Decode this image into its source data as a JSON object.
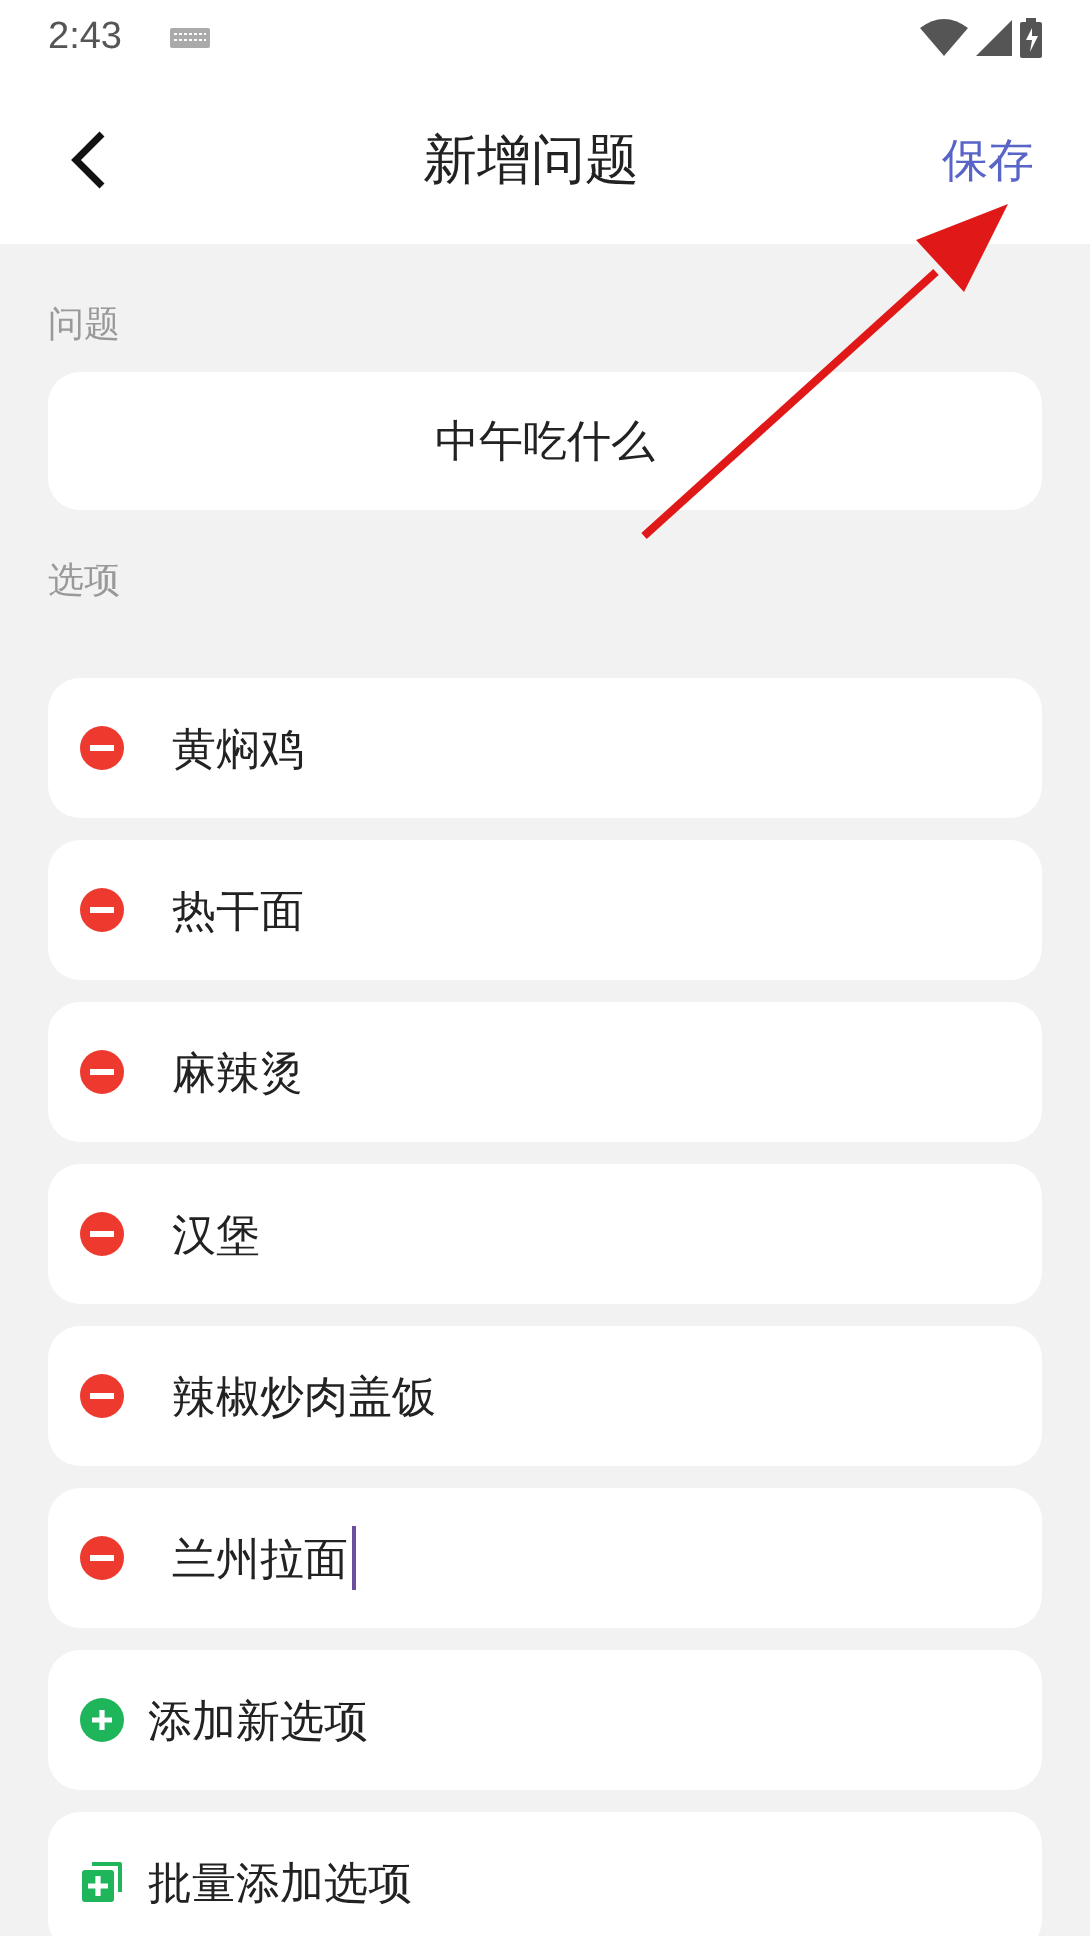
{
  "status_bar": {
    "time": "2:43"
  },
  "header": {
    "title": "新增问题",
    "save": "保存"
  },
  "question": {
    "label": "问题",
    "value": "中午吃什么"
  },
  "options_label": "选项",
  "options": [
    {
      "text": "黄焖鸡",
      "focused": false
    },
    {
      "text": "热干面",
      "focused": false
    },
    {
      "text": "麻辣烫",
      "focused": false
    },
    {
      "text": "汉堡",
      "focused": false
    },
    {
      "text": "辣椒炒肉盖饭",
      "focused": false
    },
    {
      "text": "兰州拉面",
      "focused": true
    }
  ],
  "actions": [
    {
      "kind": "add",
      "label": "添加新选项"
    },
    {
      "kind": "batch",
      "label": "批量添加选项"
    }
  ]
}
